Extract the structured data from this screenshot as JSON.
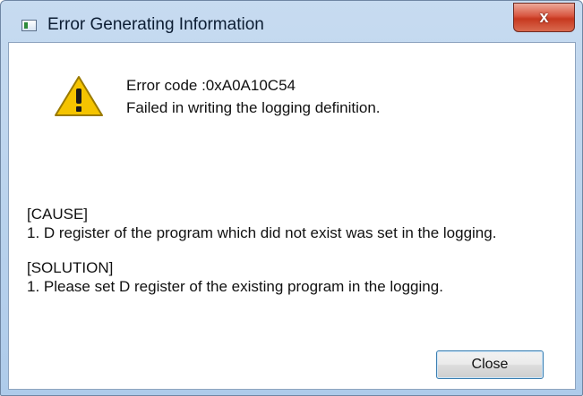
{
  "window": {
    "title": "Error Generating Information",
    "close_glyph": "x"
  },
  "message": {
    "error_code": "Error code :0xA0A10C54",
    "description": "Failed in writing the logging definition."
  },
  "cause": {
    "heading": "[CAUSE]",
    "text": "1. D register of the program which did not exist was set in the logging."
  },
  "solution": {
    "heading": "[SOLUTION]",
    "text": "1. Please set D register of the existing program in the logging."
  },
  "buttons": {
    "close_label": "Close"
  },
  "icons": {
    "app": "window-app-icon",
    "warning": "warning-icon",
    "close": "close-icon"
  },
  "colors": {
    "frame": "#c7dbf0",
    "close_red": "#c7381f",
    "warning_yellow": "#f5c400",
    "button_focus_border": "#3c7fb1"
  }
}
